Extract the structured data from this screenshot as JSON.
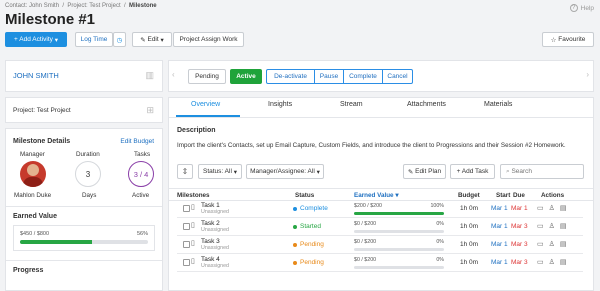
{
  "breadcrumb": {
    "contact": "Contact: John Smith",
    "project": "Project: Test Project",
    "current": "Milestone"
  },
  "help_label": "Help",
  "page_title": "Milestone #1",
  "toolbar": {
    "add_activity": "+ Add Activity",
    "log_time": "Log Time",
    "edit": "Edit",
    "assign_work": "Project Assign Work",
    "favourite": "Favourite"
  },
  "status_bar": {
    "pending": "Pending",
    "active": "Active",
    "deactivate": "De-activate",
    "pause": "Pause",
    "complete": "Complete",
    "cancel": "Cancel"
  },
  "sidebar": {
    "contact_name": "JOHN SMITH",
    "project_name": "Project: Test Project",
    "milestone_details": "Milestone Details",
    "edit_budget": "Edit Budget",
    "manager_label": "Manager",
    "manager_name": "Mahlon Duke",
    "duration_label": "Duration",
    "duration_value": "3",
    "duration_unit": "Days",
    "tasks_label": "Tasks",
    "tasks_value": "3 / 4",
    "tasks_status": "Active",
    "earned_value_label": "Earned Value",
    "earned_amount": "$450 / $800",
    "earned_pct": "56%",
    "earned_fraction": 0.56,
    "progress_label": "Progress"
  },
  "tabs": [
    "Overview",
    "Insights",
    "Stream",
    "Attachments",
    "Materials"
  ],
  "description": {
    "heading": "Description",
    "text": "Import the client's Contacts, set up Email Capture, Custom Fields, and introduce the client to Progressions and their Session #2 Homework."
  },
  "filters": {
    "status": "Status: All",
    "manager": "Manager/Assignee: All",
    "edit_plan": "Edit Plan",
    "add_task": "+ Add Task",
    "search_placeholder": "Search"
  },
  "table": {
    "headers": {
      "milestones": "Milestones",
      "status": "Status",
      "earned_value": "Earned Value",
      "budget": "Budget",
      "start": "Start",
      "due": "Due",
      "actions": "Actions"
    },
    "rows": [
      {
        "name": "Task 1",
        "assignee": "Unassigned",
        "status": "Complete",
        "status_color": "#1d8fe0",
        "ev": "$200 / $200",
        "pct": "100%",
        "fill": 1.0,
        "budget": "1h 0m",
        "start": "Mar 1",
        "due": "Mar 1"
      },
      {
        "name": "Task 2",
        "assignee": "Unassigned",
        "status": "Started",
        "status_color": "#27a644",
        "ev": "$0 / $200",
        "pct": "0%",
        "fill": 0,
        "budget": "1h 0m",
        "start": "Mar 1",
        "due": "Mar 3"
      },
      {
        "name": "Task 3",
        "assignee": "Unassigned",
        "status": "Pending",
        "status_color": "#e88a1a",
        "ev": "$0 / $200",
        "pct": "0%",
        "fill": 0,
        "budget": "1h 0m",
        "start": "Mar 1",
        "due": "Mar 3"
      },
      {
        "name": "Task 4",
        "assignee": "Unassigned",
        "status": "Pending",
        "status_color": "#e88a1a",
        "ev": "$0 / $200",
        "pct": "0%",
        "fill": 0,
        "budget": "1h 0m",
        "start": "Mar 1",
        "due": "Mar 3"
      }
    ]
  }
}
